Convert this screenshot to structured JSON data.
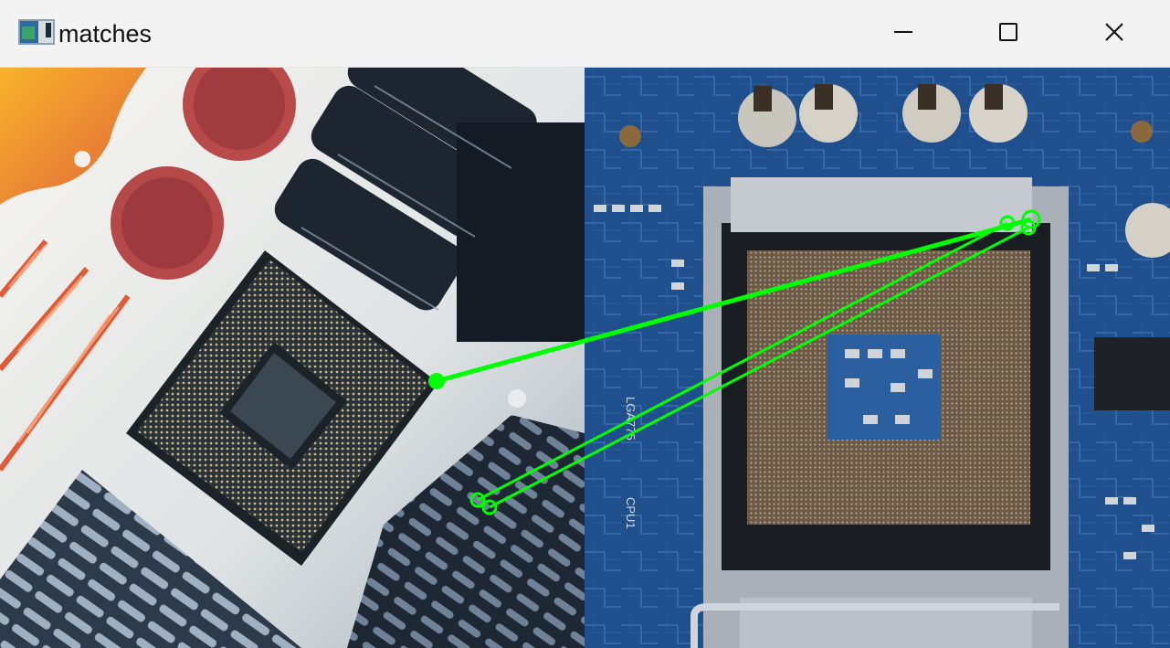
{
  "window": {
    "title": "matches",
    "icon": "image-window-icon",
    "controls": [
      "minimize-icon",
      "maximize-icon",
      "close-icon"
    ]
  },
  "images": {
    "left": "cpu-heatsink-photo",
    "right": "cpu-socket-motherboard-photo"
  },
  "board_labels": {
    "socket": "LGA775",
    "cpu": "CPU1"
  },
  "colors": {
    "match_line": "#00ff00",
    "titlebar": "#f3f3f3",
    "board": "#1f4f8c"
  },
  "match_count": 3
}
